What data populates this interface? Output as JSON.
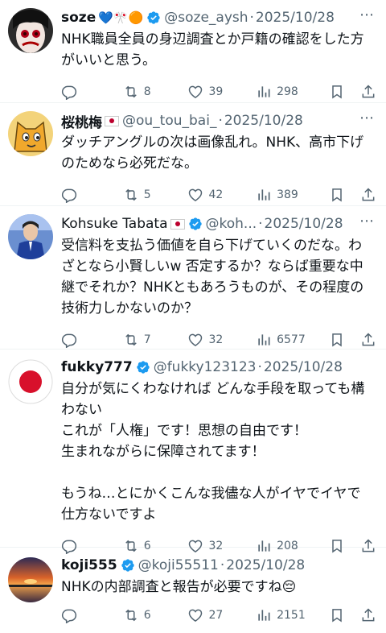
{
  "accent": "#1d9bf0",
  "posts": [
    {
      "name": "soze",
      "emojis": "💙🎌🟠",
      "verified": true,
      "handle": "@soze_aysh",
      "date": "2025/10/28",
      "text": "NHK職員全員の身辺調査とか戸籍の確認をした方がいいと思う。",
      "retweets": "8",
      "likes": "39",
      "views": "298",
      "avatar": "red-eyed-face-avatar"
    },
    {
      "name": "桜桃梅",
      "emojis": "",
      "flag": true,
      "verified": false,
      "handle": "@ou_tou_bai_",
      "date": "2025/10/28",
      "text": "ダッチアングルの次は画像乱れ。NHK、高市下げのためなら必死だな。",
      "retweets": "5",
      "likes": "42",
      "views": "389",
      "avatar": "yellow-cartoon-face-avatar"
    },
    {
      "name": "Kohsuke Tabata",
      "emojis": "",
      "flag": true,
      "verified": true,
      "handle": "@koh...",
      "date": "2025/10/28",
      "text": "受信料を支払う価値を自ら下げていくのだな。わざとなら小賢しいw 否定するか？ならば重要な中継でそれか？NHKともあろうものが、その程度の技術力しかないのか？",
      "retweets": "7",
      "likes": "32",
      "views": "6577",
      "avatar": "man-in-suit-avatar"
    },
    {
      "name": "fukky777",
      "emojis": "",
      "verified": true,
      "handle": "@fukky123123",
      "date": "2025/10/28",
      "text": "自分が気にくわなければ どんな手段を取っても構わない\nこれが「人権」です！思想の自由です！\n生まれながらに保障されてます！\n\nもうね…とにかくこんな我儘な人がイヤでイヤで仕方ないですよ",
      "retweets": "6",
      "likes": "32",
      "views": "208",
      "avatar": "japan-flag-avatar"
    },
    {
      "name": "koji555",
      "emojis": "",
      "verified": true,
      "handle": "@koji55511",
      "date": "2025/10/28",
      "text": "NHKの内部調査と報告が必要ですね😔",
      "retweets": "6",
      "likes": "27",
      "views": "2151",
      "avatar": "sunset-avatar"
    }
  ]
}
